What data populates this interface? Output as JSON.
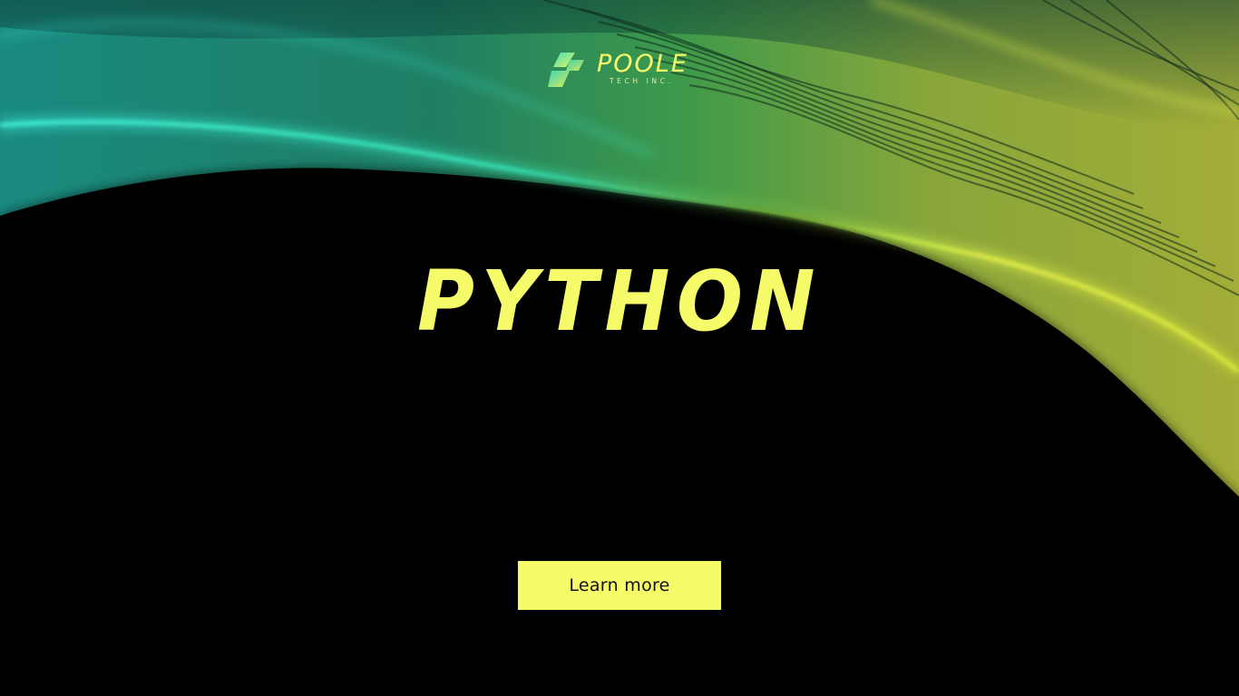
{
  "brand": {
    "name": "POOLE",
    "tagline": "TECH INC."
  },
  "hero": {
    "title": "PYTHON"
  },
  "cta": {
    "label": "Learn more"
  },
  "colors": {
    "background": "#000000",
    "accent_yellow": "#f6fb6a",
    "wave_teal": "#2ee6c2",
    "wave_green": "#3fae6a",
    "wave_olive": "#a6b43a"
  },
  "icons": {
    "logo": "lightning-bolt-logo-icon"
  }
}
